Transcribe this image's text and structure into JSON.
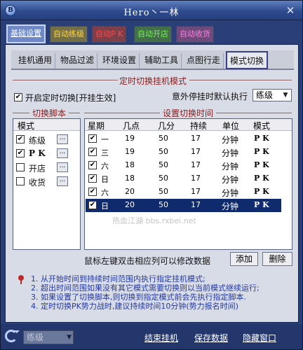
{
  "window": {
    "title": "Hero丶一林",
    "close_glyph": "✕",
    "app_icon": "B"
  },
  "main_tabs": [
    {
      "label": "基础设置",
      "color": "#ffffff",
      "bg": "#6a86c8"
    },
    {
      "label": "自动练级",
      "color": "#ffd84a",
      "bg": "#6f6b45"
    },
    {
      "label": "自动P K",
      "color": "#ff4848",
      "bg": "#7a3b46"
    },
    {
      "label": "自动开店",
      "color": "#79f15c",
      "bg": "#3f6b44"
    },
    {
      "label": "自动收货",
      "color": "#ff7ee0",
      "bg": "#6a4678"
    }
  ],
  "sub_tabs": [
    "挂机通用",
    "物品过滤",
    "环境设置",
    "辅助工具",
    "点图行走",
    "模式切换"
  ],
  "timer": {
    "section_title": "定时切换挂机模式",
    "enable_label": "开启定时切换[开挂生效]",
    "enable_checked": "✔",
    "fallback_label": "意外停挂时默认执行",
    "fallback_value": "练级"
  },
  "scripts": {
    "section_title": "切换脚本",
    "header": "模式",
    "items": [
      {
        "label": "练级",
        "check": "✔",
        "btn": "..."
      },
      {
        "label": "P K",
        "check": "✔",
        "btn": "..."
      },
      {
        "label": "开店",
        "check": "",
        "btn": "..."
      },
      {
        "label": "收货",
        "check": "",
        "btn": "..."
      }
    ]
  },
  "schedule": {
    "section_title": "设置切换时间",
    "headers": [
      "星期",
      "几点",
      "几分",
      "持续",
      "单位",
      "模式"
    ],
    "rows": [
      {
        "check": "✔",
        "day": "一",
        "hour": "19",
        "minute": "50",
        "duration": "17",
        "unit": "分钟",
        "mode": "P K"
      },
      {
        "check": "✔",
        "day": "三",
        "hour": "19",
        "minute": "50",
        "duration": "17",
        "unit": "分钟",
        "mode": "P K"
      },
      {
        "check": "✔",
        "day": "六",
        "hour": "18",
        "minute": "50",
        "duration": "17",
        "unit": "分钟",
        "mode": "P K"
      },
      {
        "check": "✔",
        "day": "日",
        "hour": "18",
        "minute": "50",
        "duration": "17",
        "unit": "分钟",
        "mode": "P K"
      },
      {
        "check": "✔",
        "day": "六",
        "hour": "20",
        "minute": "50",
        "duration": "17",
        "unit": "分钟",
        "mode": "P K"
      },
      {
        "check": "✔",
        "day": "日",
        "hour": "20",
        "minute": "50",
        "duration": "17",
        "unit": "分钟",
        "mode": "P K"
      }
    ]
  },
  "hint": "鼠标左键双击相应列可以修改数据",
  "add_button": "添加",
  "delete_button": "删除",
  "notes": [
    "1. 从开始时间到持续时间范围内执行指定挂机模式;",
    "2. 超出时间范围如果没有其它模式需要切换则以当前模式继续运行;",
    "3. 如果设置了切换脚本,则切换到指定模式前会先执行指定脚本.",
    "4. 定时切换PK势力战时,建议持续时间10分钟(势力报名时间)"
  ],
  "watermark": "热血江湖 bbs.rxbei.net",
  "bottom": {
    "mode_select": "练级",
    "end_label": "结束挂机",
    "save_label": "保存数据",
    "hide_label": "隐藏窗口"
  }
}
